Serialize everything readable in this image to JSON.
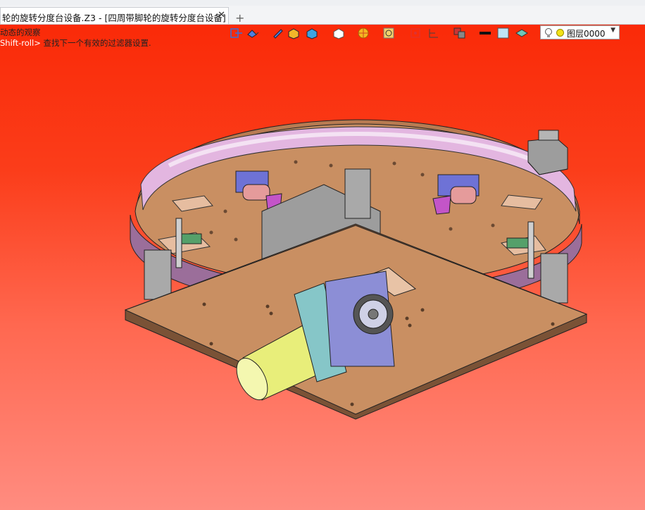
{
  "tab": {
    "title": "轮的旋转分度台设备.Z3 - [四周带脚轮的旋转分度台设备]",
    "close_glyph": "✕",
    "add_glyph": "+"
  },
  "viewport": {
    "hint_line1": "动态的观察",
    "hint_line2_key": "Shift-roll>",
    "hint_line2_text": " 查找下一个有效的过滤器设置.",
    "background_top": "#fa2a08",
    "background_bottom": "#ff8c80"
  },
  "toolbar": {
    "icons": [
      "exit-sketch-icon",
      "display-mode-icon",
      "pen-icon",
      "shaded-box-icon",
      "render-cube-icon",
      "view-cube-icon",
      "filter-icon",
      "zoom-icon",
      "fit-view-icon",
      "section-icon",
      "layer-stack-icon",
      "line-color-icon",
      "fill-color-icon",
      "material-icon"
    ],
    "layer_label": "图层0000"
  },
  "colors": {
    "plate": "#c98f62",
    "ring": "#d9a0d4",
    "motor": "#e8ee7a",
    "bracket": "#8c8ed6",
    "accent_blue": "#4f7fe0"
  }
}
